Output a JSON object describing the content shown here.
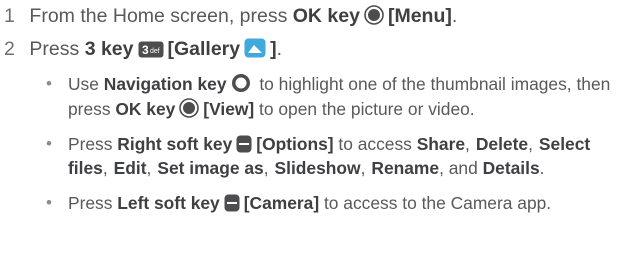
{
  "steps": [
    {
      "num": "1",
      "text1": "From the Home screen, press ",
      "key": "OK key",
      "bracket": "[Menu]",
      "end": "."
    },
    {
      "num": "2",
      "text1": "Press ",
      "key": "3 key",
      "bracket_open": "[Gallery",
      "bracket_close": "]",
      "end": "."
    }
  ],
  "bullets": {
    "b1": {
      "t1": "Use ",
      "k1": "Navigation key",
      "t2": " to highlight one of the thumbnail images, then press ",
      "k2": "OK key",
      "k3": "[View]",
      "t3": " to open the picture or video."
    },
    "b2": {
      "t1": "Press ",
      "k1": "Right soft key",
      "k2": "[Options]",
      "t2": " to access ",
      "o1": "Share",
      ",": ",",
      "o2": "Delete",
      "o3": "Select files",
      "o4": "Edit",
      "o5": "Set image as",
      "o6": "Slideshow",
      "o7": "Rename",
      "t3": ", and ",
      "o8": "Details",
      "end": "."
    },
    "b3": {
      "t1": "Press ",
      "k1": "Left soft key",
      "k2": "[Camera]",
      "t2": " to access to the Camera app."
    }
  },
  "icons": {
    "ok_key": "ok-key-icon",
    "three_key": "three-key-icon",
    "gallery": "gallery-icon",
    "navigation_key": "navigation-key-icon",
    "soft_key": "soft-key-icon",
    "colors": {
      "text": "#58595b",
      "bold": "#3f4043",
      "icon": "#4d4d4f"
    }
  }
}
